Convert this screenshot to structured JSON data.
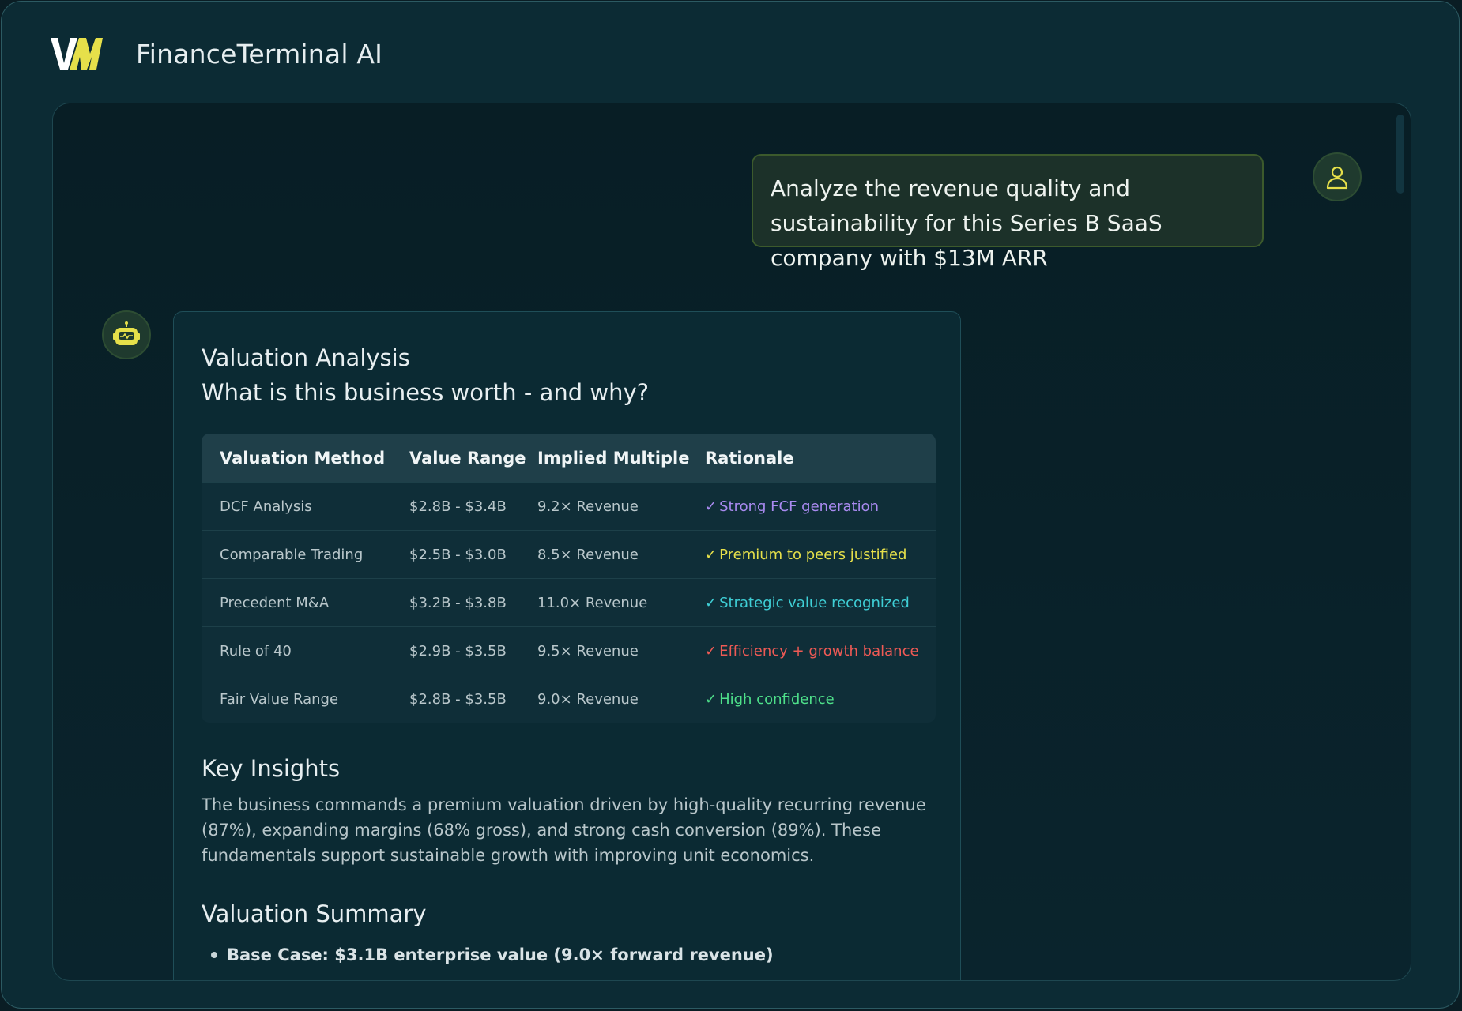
{
  "header": {
    "logo_text": "VM",
    "app_title": "FinanceTerminal AI"
  },
  "chat": {
    "user_message": "Analyze the revenue quality and sustainability for this Series B SaaS company with $13M ARR",
    "assistant": {
      "title_line1": "Valuation Analysis",
      "title_line2": "What is this business worth - and why?",
      "table": {
        "columns": [
          "Valuation Method",
          "Value Range",
          "Implied Multiple",
          "Rationale"
        ],
        "rows": [
          {
            "method": "DCF Analysis",
            "range": "$2.8B - $3.4B",
            "multiple": "9.2× Revenue",
            "rationale": "Strong FCF generation",
            "color": "#a98af0"
          },
          {
            "method": "Comparable Trading",
            "range": "$2.5B - $3.0B",
            "multiple": "8.5× Revenue",
            "rationale": "Premium to peers justified",
            "color": "#e6e04a"
          },
          {
            "method": "Precedent M&A",
            "range": "$3.2B - $3.8B",
            "multiple": "11.0× Revenue",
            "rationale": "Strategic value recognized",
            "color": "#3fcfd6"
          },
          {
            "method": "Rule of 40",
            "range": "$2.9B - $3.5B",
            "multiple": "9.5× Revenue",
            "rationale": "Efficiency + growth balance",
            "color": "#ef5a55"
          },
          {
            "method": "Fair Value Range",
            "range": "$2.8B - $3.5B",
            "multiple": "9.0× Revenue",
            "rationale": "High confidence",
            "color": "#4ee08a"
          }
        ]
      },
      "key_insights_title": "Key Insights",
      "key_insights_text": "The business commands a premium valuation driven by high-quality recurring revenue (87%), expanding margins (68% gross), and strong cash conversion (89%). These fundamentals support sustainable growth with improving unit economics.",
      "summary_title": "Valuation Summary",
      "summary_items": [
        "Base Case: $3.1B enterprise value (9.0× forward revenue)"
      ]
    }
  },
  "icons": {
    "check": "✓",
    "user": "user-icon",
    "bot": "robot-icon"
  },
  "colors": {
    "accent_yellow": "#e6e04a",
    "panel_bg": "#081e25",
    "card_bg": "#0b2a33"
  }
}
